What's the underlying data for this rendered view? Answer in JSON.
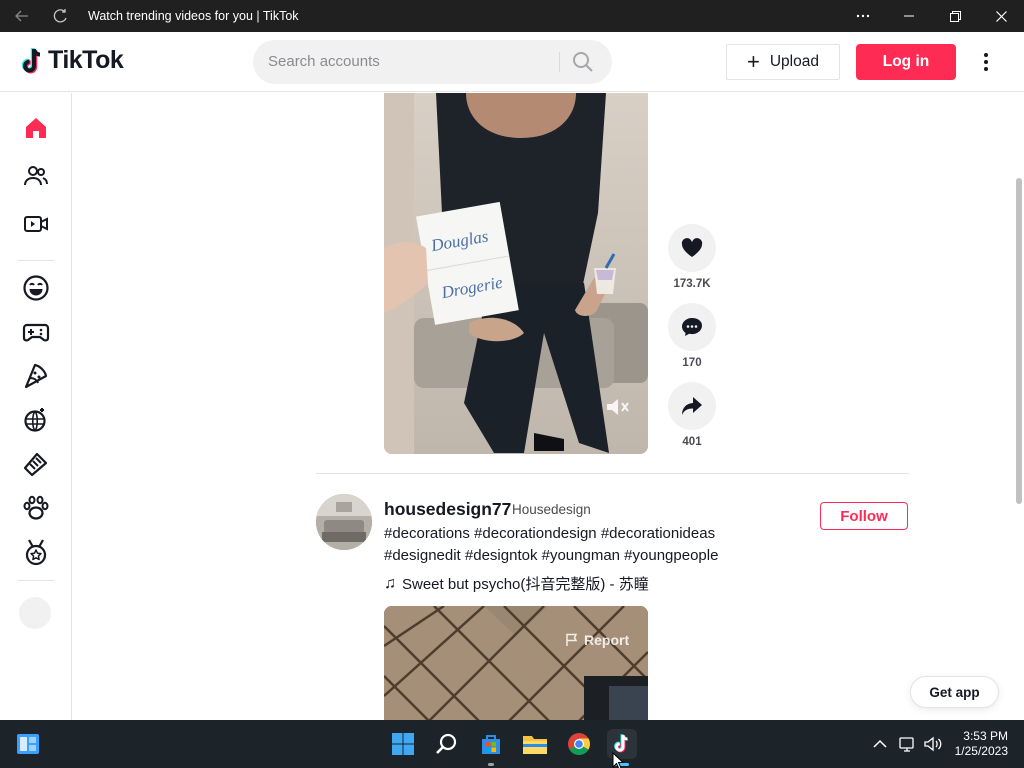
{
  "window": {
    "title": "Watch trending videos for you | TikTok"
  },
  "header": {
    "logo_text": "TikTok",
    "search_placeholder": "Search accounts",
    "upload_label": "Upload",
    "login_label": "Log in"
  },
  "sidebar": {
    "items": [
      {
        "icon": "home-icon"
      },
      {
        "icon": "following-icon"
      },
      {
        "icon": "live-icon"
      },
      {
        "icon": "comedy-icon"
      },
      {
        "icon": "gaming-icon"
      },
      {
        "icon": "food-icon"
      },
      {
        "icon": "dance-icon"
      },
      {
        "icon": "beauty-icon"
      },
      {
        "icon": "animals-icon"
      },
      {
        "icon": "sports-icon"
      }
    ],
    "accent_color": "#fe2c55"
  },
  "video1": {
    "actions": {
      "likes": "173.7K",
      "comments": "170",
      "shares": "401"
    }
  },
  "post2": {
    "username": "housedesign77",
    "nickname": "Housedesign",
    "caption_line1": "#decorations #decorationdesign #decorationideas",
    "caption_line2": "#designedit #designtok #youngman #youngpeople",
    "music": "Sweet but psycho(抖音完整版) - 苏瞳",
    "follow_label": "Follow",
    "report_label": "Report"
  },
  "get_app_label": "Get app",
  "taskbar": {
    "time": "3:53 PM",
    "date": "1/25/2023"
  }
}
